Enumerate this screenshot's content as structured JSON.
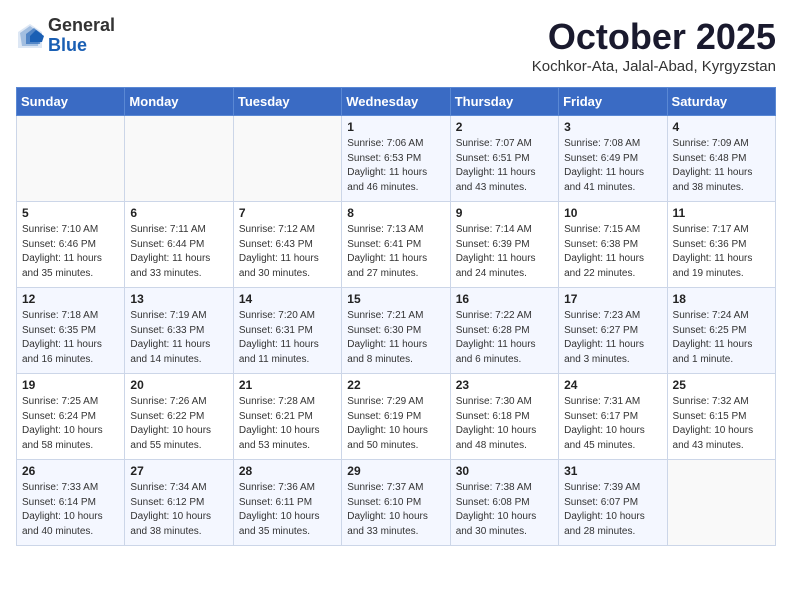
{
  "header": {
    "logo_general": "General",
    "logo_blue": "Blue",
    "month_title": "October 2025",
    "location": "Kochkor-Ata, Jalal-Abad, Kyrgyzstan"
  },
  "weekdays": [
    "Sunday",
    "Monday",
    "Tuesday",
    "Wednesday",
    "Thursday",
    "Friday",
    "Saturday"
  ],
  "weeks": [
    [
      {
        "day": "",
        "text": ""
      },
      {
        "day": "",
        "text": ""
      },
      {
        "day": "",
        "text": ""
      },
      {
        "day": "1",
        "text": "Sunrise: 7:06 AM\nSunset: 6:53 PM\nDaylight: 11 hours\nand 46 minutes."
      },
      {
        "day": "2",
        "text": "Sunrise: 7:07 AM\nSunset: 6:51 PM\nDaylight: 11 hours\nand 43 minutes."
      },
      {
        "day": "3",
        "text": "Sunrise: 7:08 AM\nSunset: 6:49 PM\nDaylight: 11 hours\nand 41 minutes."
      },
      {
        "day": "4",
        "text": "Sunrise: 7:09 AM\nSunset: 6:48 PM\nDaylight: 11 hours\nand 38 minutes."
      }
    ],
    [
      {
        "day": "5",
        "text": "Sunrise: 7:10 AM\nSunset: 6:46 PM\nDaylight: 11 hours\nand 35 minutes."
      },
      {
        "day": "6",
        "text": "Sunrise: 7:11 AM\nSunset: 6:44 PM\nDaylight: 11 hours\nand 33 minutes."
      },
      {
        "day": "7",
        "text": "Sunrise: 7:12 AM\nSunset: 6:43 PM\nDaylight: 11 hours\nand 30 minutes."
      },
      {
        "day": "8",
        "text": "Sunrise: 7:13 AM\nSunset: 6:41 PM\nDaylight: 11 hours\nand 27 minutes."
      },
      {
        "day": "9",
        "text": "Sunrise: 7:14 AM\nSunset: 6:39 PM\nDaylight: 11 hours\nand 24 minutes."
      },
      {
        "day": "10",
        "text": "Sunrise: 7:15 AM\nSunset: 6:38 PM\nDaylight: 11 hours\nand 22 minutes."
      },
      {
        "day": "11",
        "text": "Sunrise: 7:17 AM\nSunset: 6:36 PM\nDaylight: 11 hours\nand 19 minutes."
      }
    ],
    [
      {
        "day": "12",
        "text": "Sunrise: 7:18 AM\nSunset: 6:35 PM\nDaylight: 11 hours\nand 16 minutes."
      },
      {
        "day": "13",
        "text": "Sunrise: 7:19 AM\nSunset: 6:33 PM\nDaylight: 11 hours\nand 14 minutes."
      },
      {
        "day": "14",
        "text": "Sunrise: 7:20 AM\nSunset: 6:31 PM\nDaylight: 11 hours\nand 11 minutes."
      },
      {
        "day": "15",
        "text": "Sunrise: 7:21 AM\nSunset: 6:30 PM\nDaylight: 11 hours\nand 8 minutes."
      },
      {
        "day": "16",
        "text": "Sunrise: 7:22 AM\nSunset: 6:28 PM\nDaylight: 11 hours\nand 6 minutes."
      },
      {
        "day": "17",
        "text": "Sunrise: 7:23 AM\nSunset: 6:27 PM\nDaylight: 11 hours\nand 3 minutes."
      },
      {
        "day": "18",
        "text": "Sunrise: 7:24 AM\nSunset: 6:25 PM\nDaylight: 11 hours\nand 1 minute."
      }
    ],
    [
      {
        "day": "19",
        "text": "Sunrise: 7:25 AM\nSunset: 6:24 PM\nDaylight: 10 hours\nand 58 minutes."
      },
      {
        "day": "20",
        "text": "Sunrise: 7:26 AM\nSunset: 6:22 PM\nDaylight: 10 hours\nand 55 minutes."
      },
      {
        "day": "21",
        "text": "Sunrise: 7:28 AM\nSunset: 6:21 PM\nDaylight: 10 hours\nand 53 minutes."
      },
      {
        "day": "22",
        "text": "Sunrise: 7:29 AM\nSunset: 6:19 PM\nDaylight: 10 hours\nand 50 minutes."
      },
      {
        "day": "23",
        "text": "Sunrise: 7:30 AM\nSunset: 6:18 PM\nDaylight: 10 hours\nand 48 minutes."
      },
      {
        "day": "24",
        "text": "Sunrise: 7:31 AM\nSunset: 6:17 PM\nDaylight: 10 hours\nand 45 minutes."
      },
      {
        "day": "25",
        "text": "Sunrise: 7:32 AM\nSunset: 6:15 PM\nDaylight: 10 hours\nand 43 minutes."
      }
    ],
    [
      {
        "day": "26",
        "text": "Sunrise: 7:33 AM\nSunset: 6:14 PM\nDaylight: 10 hours\nand 40 minutes."
      },
      {
        "day": "27",
        "text": "Sunrise: 7:34 AM\nSunset: 6:12 PM\nDaylight: 10 hours\nand 38 minutes."
      },
      {
        "day": "28",
        "text": "Sunrise: 7:36 AM\nSunset: 6:11 PM\nDaylight: 10 hours\nand 35 minutes."
      },
      {
        "day": "29",
        "text": "Sunrise: 7:37 AM\nSunset: 6:10 PM\nDaylight: 10 hours\nand 33 minutes."
      },
      {
        "day": "30",
        "text": "Sunrise: 7:38 AM\nSunset: 6:08 PM\nDaylight: 10 hours\nand 30 minutes."
      },
      {
        "day": "31",
        "text": "Sunrise: 7:39 AM\nSunset: 6:07 PM\nDaylight: 10 hours\nand 28 minutes."
      },
      {
        "day": "",
        "text": ""
      }
    ]
  ]
}
